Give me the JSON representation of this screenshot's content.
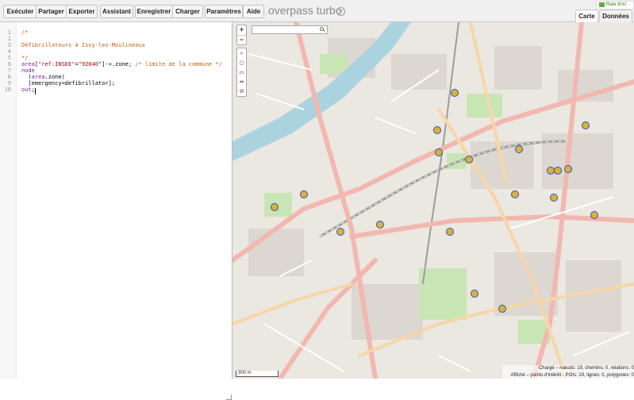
{
  "toolbar": {
    "run": "Exécuter",
    "share": "Partager",
    "export": "Exporter",
    "wizard": "Assistant",
    "save": "Enregistrer",
    "load": "Charger",
    "settings": "Paramètres",
    "help": "Aide",
    "brand": "overpass turbo"
  },
  "tabs": {
    "map": "Carte",
    "data": "Données"
  },
  "rate": "Rate this!",
  "editor": {
    "line_numbers": [
      "1",
      "2",
      "3",
      "4",
      "5",
      "6",
      "7",
      "8",
      "9",
      "10"
    ],
    "lines": {
      "l1": "/*",
      "l3": "Défibrillateurs à Issy-les-Moulineaux",
      "l5": "*/",
      "l6_kw": "area",
      "l6_open": "[",
      "l6_key": "\"ref:INSEE\"",
      "l6_eq": "=",
      "l6_val": "\"92040\"",
      "l6_rest": "]->.zone; ",
      "l6_comment": "/* limite de la commune */",
      "l7": "node",
      "l8_paren": "  (",
      "l8_kw": "area",
      "l8_rest": ".zone)",
      "l9": "  [emergency=defibrillator];",
      "l10_kw": "out",
      "l10_rest": ";"
    }
  },
  "map": {
    "scale": "300 m",
    "status_line1": "Chargé – nœuds: 19, chemins: 0, relations: 0",
    "status_line2": "Affiché – points d'intérêt - POIs: 19, lignes: 0, polygones: 0",
    "marker_count": 19
  },
  "colors": {
    "marker_fill": "#e0b030",
    "marker_stroke": "#2255cc",
    "river": "#aad3df",
    "park": "#c8e6b4",
    "road_major": "#f2b8b0"
  }
}
